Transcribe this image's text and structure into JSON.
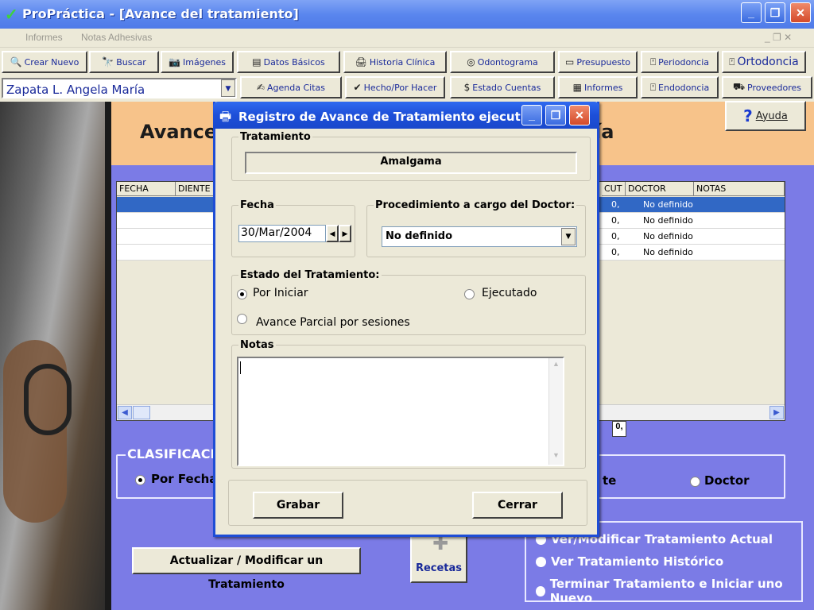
{
  "window": {
    "title": "ProPráctica - [Avance del tratamiento]",
    "controls": [
      "_",
      "❐",
      "✕"
    ]
  },
  "menu": {
    "items": [
      "Informes",
      "Notas Adhesivas"
    ],
    "mdi_controls": "_ ❐ ✕"
  },
  "toolbar": {
    "row1": [
      {
        "label": "Crear Nuevo",
        "icon": "🔍"
      },
      {
        "label": "Buscar",
        "icon": "🔭"
      },
      {
        "label": "Imágenes",
        "icon": "📷"
      },
      {
        "label": "Datos Básicos",
        "icon": "▤"
      },
      {
        "label": "Historia Clínica",
        "icon": "🖨"
      },
      {
        "label": "Odontograma",
        "icon": "◎"
      },
      {
        "label": "Presupuesto",
        "icon": "▭"
      },
      {
        "label": "Periodoncia",
        "icon": "⍞"
      },
      {
        "label": "Ortodoncia",
        "icon": "⍞"
      }
    ],
    "row2": [
      {
        "label": "Agenda Citas",
        "icon": "✍"
      },
      {
        "label": "Hecho/Por Hacer",
        "icon": "✔"
      },
      {
        "label": "Estado Cuentas",
        "icon": "$"
      },
      {
        "label": "Informes",
        "icon": "▦"
      },
      {
        "label": "Endodoncia",
        "icon": "⍞"
      },
      {
        "label": "Proveedores",
        "icon": "⛟"
      }
    ]
  },
  "patient": {
    "selected": "Zapata L. Angela María"
  },
  "help_button": {
    "label": "Ayuda",
    "icon": "?"
  },
  "page_header": {
    "left": "Avance",
    "right": "ía"
  },
  "grid": {
    "headers_left": [
      "FECHA",
      "DIENTE"
    ],
    "headers_right": [
      "CUT",
      "DOCTOR",
      "NOTAS"
    ],
    "rows": [
      {
        "ejec": "0,",
        "doctor": "No definido",
        "selected": true
      },
      {
        "ejec": "0,",
        "doctor": "No definido",
        "selected": false
      },
      {
        "ejec": "0,",
        "doctor": "No definido",
        "selected": false
      },
      {
        "ejec": "0,",
        "doctor": "No definido",
        "selected": false
      }
    ],
    "total": "0,"
  },
  "classification": {
    "label": "CLASIFICACIO",
    "options": [
      {
        "label": "Por Fecha",
        "checked": true
      },
      {
        "label": "te",
        "checked": false
      },
      {
        "label": "Doctor",
        "checked": false
      }
    ]
  },
  "bottom": {
    "update_button": "Actualizar / Modificar un Tratamiento",
    "recetas": "Recetas",
    "options": [
      "Ver/Modificar Tratamiento Actual",
      "Ver Tratamiento Histórico",
      "Terminar Tratamiento e Iniciar uno Nuevo"
    ]
  },
  "dialog": {
    "title": "Registro de Avance de Tratamiento ejecut...",
    "tratamiento_label": "Tratamiento",
    "tratamiento_value": "Amalgama",
    "fecha_label": "Fecha",
    "fecha_value": "30/Mar/2004",
    "procedimiento_label": "Procedimiento a cargo del Doctor:",
    "procedimiento_value": "No definido",
    "estado_label": "Estado del Tratamiento:",
    "estado_options": [
      {
        "label": "Por Iniciar",
        "checked": true
      },
      {
        "label": "Ejecutado",
        "checked": false
      },
      {
        "label": "Avance Parcial por sesiones",
        "checked": false
      }
    ],
    "notas_label": "Notas",
    "notas_value": "",
    "grabar": "Grabar",
    "cerrar": "Cerrar"
  },
  "colors": {
    "accent": "#1e4dd6",
    "background": "#7b7be6",
    "header_band": "#f7c38a",
    "selection": "#3168c5"
  }
}
